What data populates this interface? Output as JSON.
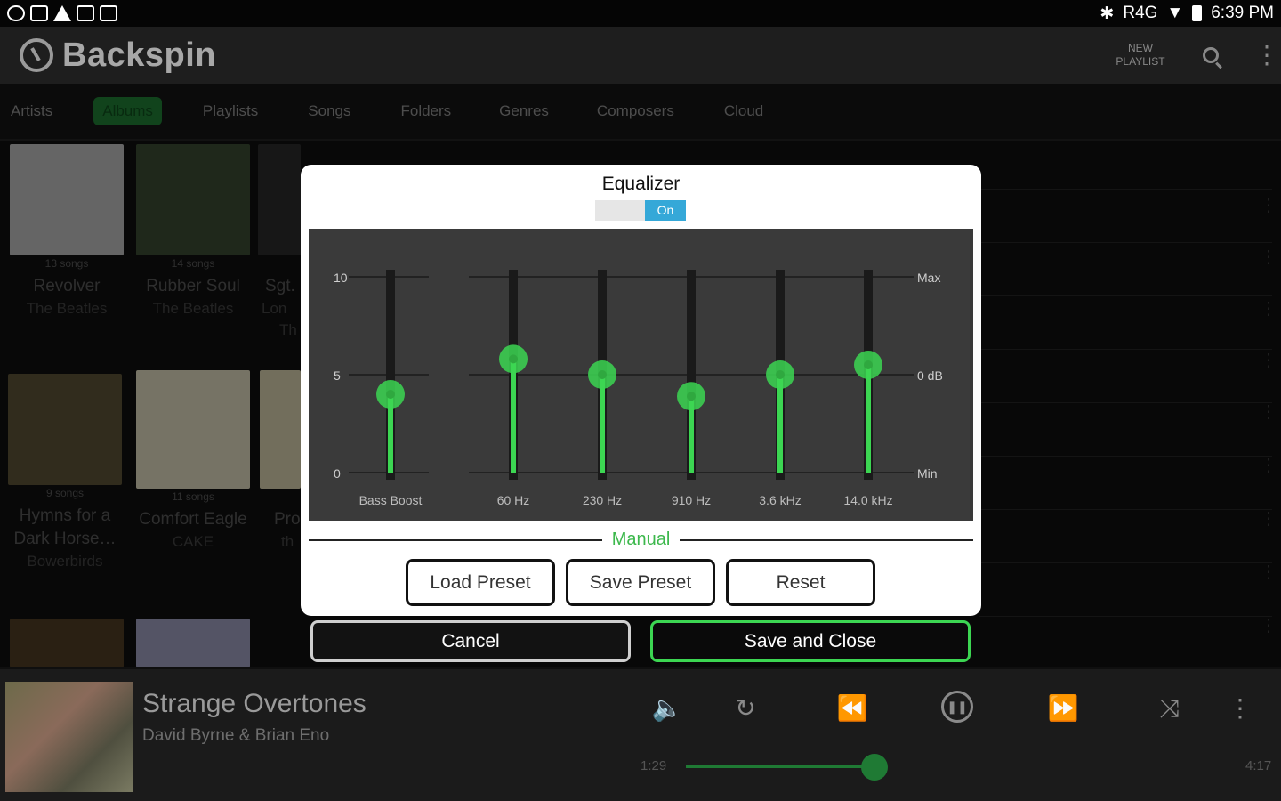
{
  "status_bar": {
    "time": "6:39 PM",
    "signal": "R4G"
  },
  "app": {
    "title": "Backspin",
    "new_playlist": "NEW PLAYLIST"
  },
  "tabs": [
    {
      "label": "Artists"
    },
    {
      "label": "Albums",
      "active": true
    },
    {
      "label": "Playlists"
    },
    {
      "label": "Songs"
    },
    {
      "label": "Folders"
    },
    {
      "label": "Genres"
    },
    {
      "label": "Composers"
    },
    {
      "label": "Cloud"
    }
  ],
  "albums": [
    {
      "title": "Revolver",
      "artist": "The Beatles",
      "count": "13 songs",
      "cover_color": "#b8b8b8"
    },
    {
      "title": "Rubber Soul",
      "artist": "The Beatles",
      "count": "14 songs",
      "cover_color": "#3a4a32"
    },
    {
      "title": "Hymns for a Dark Horse…",
      "artist": "Bowerbirds",
      "count": "9 songs",
      "cover_color": "#5a5036"
    },
    {
      "title": "Comfort Eagle",
      "artist": "CAKE",
      "count": "11 songs",
      "cover_color": "#d8d2b8"
    }
  ],
  "partial_albums": [
    {
      "line1": "Sgt.",
      "line2": "Lon",
      "line3": "Th"
    },
    {
      "line1": "Pro",
      "line2": "th"
    }
  ],
  "equalizer": {
    "title": "Equalizer",
    "toggle_label": "On",
    "scale_left": [
      "10",
      "5",
      "0"
    ],
    "scale_right": [
      "Max",
      "0 dB",
      "Min"
    ],
    "bands": [
      {
        "label": "Bass Boost",
        "value": 4.0
      },
      {
        "label": "60 Hz",
        "value": 5.8
      },
      {
        "label": "230 Hz",
        "value": 5.0
      },
      {
        "label": "910 Hz",
        "value": 3.9
      },
      {
        "label": "3.6 kHz",
        "value": 5.0
      },
      {
        "label": "14.0 kHz",
        "value": 5.5
      }
    ],
    "range": [
      0,
      10
    ],
    "accent_color": "#3cd652",
    "preset_name": "Manual",
    "load_preset": "Load Preset",
    "save_preset": "Save Preset",
    "reset": "Reset"
  },
  "dialog_buttons": {
    "cancel": "Cancel",
    "save_close": "Save and Close"
  },
  "now_playing": {
    "title": "Strange Overtones",
    "artist": "David Byrne & Brian Eno",
    "elapsed": "1:29",
    "duration": "4:17",
    "progress": 0.35
  }
}
